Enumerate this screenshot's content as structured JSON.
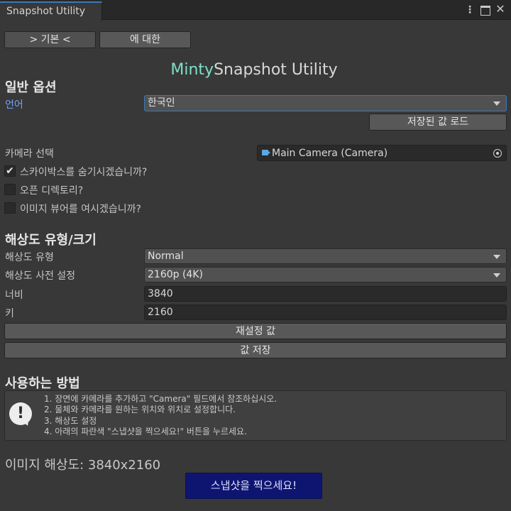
{
  "window": {
    "tab_title": "Snapshot Utility",
    "kebab_glyph": "⋮",
    "close_glyph": "✕"
  },
  "nav": {
    "basic_label": "> 기본 <",
    "about_label": "에 대한"
  },
  "app_title": {
    "brand": "Minty",
    "rest": "Snapshot Utility"
  },
  "general": {
    "heading": "일반 옵션",
    "language_label": "언어",
    "language_value": "한국인",
    "load_saved_label": "저장된 값 로드",
    "camera_label": "카메라 선택",
    "camera_value": "Main Camera (Camera)",
    "hide_skybox_label": "스카이박스를 숨기시겠습니까?",
    "hide_skybox_checked": true,
    "open_dir_label": "오픈 디렉토리?",
    "open_dir_checked": false,
    "open_viewer_label": "이미지 뷰어를 여시겠습니까?",
    "open_viewer_checked": false,
    "check_glyph": "✔"
  },
  "resolution": {
    "heading": "해상도 유형/크기",
    "type_label": "해상도 유형",
    "type_value": "Normal",
    "preset_label": "해상도 사전 설정",
    "preset_value": "2160p (4K)",
    "width_label": "너비",
    "width_value": "3840",
    "height_label": "키",
    "height_value": "2160",
    "reset_label": "재설정 값",
    "save_label": "값 저장"
  },
  "howto": {
    "heading": "사용하는 방법",
    "icon_glyph": "!",
    "lines": [
      "1. 장면에 카메라를 추가하고 \"Camera\" 필드에서 참조하십시오.",
      "2. 물체와 카메라를 원하는 위치와 위치로 설정합니다.",
      "3. 해상도 설정",
      "4. 아래의 파란색 \"스냅샷을 찍으세요!\" 버튼을 누르세요."
    ]
  },
  "footer": {
    "image_resolution": "이미지 해상도: 3840x2160",
    "snapshot_label": "스냅샷을 찍으세요!"
  },
  "colors": {
    "background": "#383838",
    "primary_button": "#0e1571",
    "brand": "#7ee0c8",
    "label_accent": "#6fa3f5",
    "focus": "#3a79bb"
  }
}
